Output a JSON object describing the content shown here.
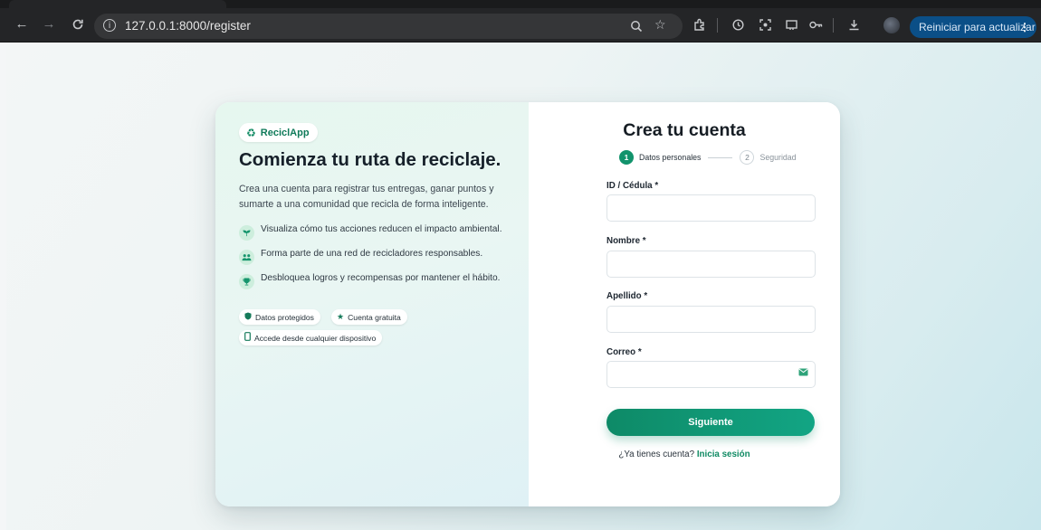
{
  "browser": {
    "url": "127.0.0.1:8000/register",
    "update_button": "Reiniciar para actualizar",
    "icons": [
      "back-icon",
      "forward-icon",
      "reload-icon",
      "site-info-icon",
      "zoom-icon",
      "bookmark-star-icon",
      "extensions-icon",
      "history-icon",
      "screenshot-icon",
      "cast-icon",
      "password-key-icon",
      "download-icon",
      "profile-avatar",
      "more-menu-icon"
    ]
  },
  "brand": {
    "name": "ReciclApp",
    "icon": "recycle-icon",
    "color": "#0f8a63"
  },
  "left": {
    "headline": "Comienza tu ruta de reciclaje.",
    "intro": "Crea una cuenta para registrar tus entregas, ganar puntos y sumarte a una comunidad que recicla de forma inteligente.",
    "features": [
      {
        "icon": "sprout-icon",
        "text": "Visualiza cómo tus acciones reducen el impacto ambiental."
      },
      {
        "icon": "users-icon",
        "text": "Forma parte de una red de recicladores responsables."
      },
      {
        "icon": "trophy-icon",
        "text": "Desbloquea logros y recompensas por mantener el hábito."
      }
    ],
    "badges": [
      {
        "icon": "shield-icon",
        "text": "Datos protegidos"
      },
      {
        "icon": "star-icon",
        "text": "Cuenta gratuita"
      },
      {
        "icon": "mobile-icon",
        "text": "Accede desde cualquier dispositivo"
      }
    ]
  },
  "form": {
    "title": "Crea tu cuenta",
    "steps": [
      {
        "number": "1",
        "label": "Datos personales",
        "active": true
      },
      {
        "number": "2",
        "label": "Seguridad",
        "active": false
      }
    ],
    "fields": [
      {
        "label": "ID / Cédula *",
        "value": ""
      },
      {
        "label": "Nombre *",
        "value": ""
      },
      {
        "label": "Apellido *",
        "value": ""
      },
      {
        "label": "Correo *",
        "value": "",
        "icon": "mail-icon"
      }
    ],
    "submit_label": "Siguiente",
    "login_prompt": "¿Ya tienes cuenta?",
    "login_link": "Inicia sesión"
  },
  "colors": {
    "accent": "#12936c",
    "button_start": "#0e8a67",
    "button_end": "#12a584",
    "update_button": "#0b4f87"
  }
}
